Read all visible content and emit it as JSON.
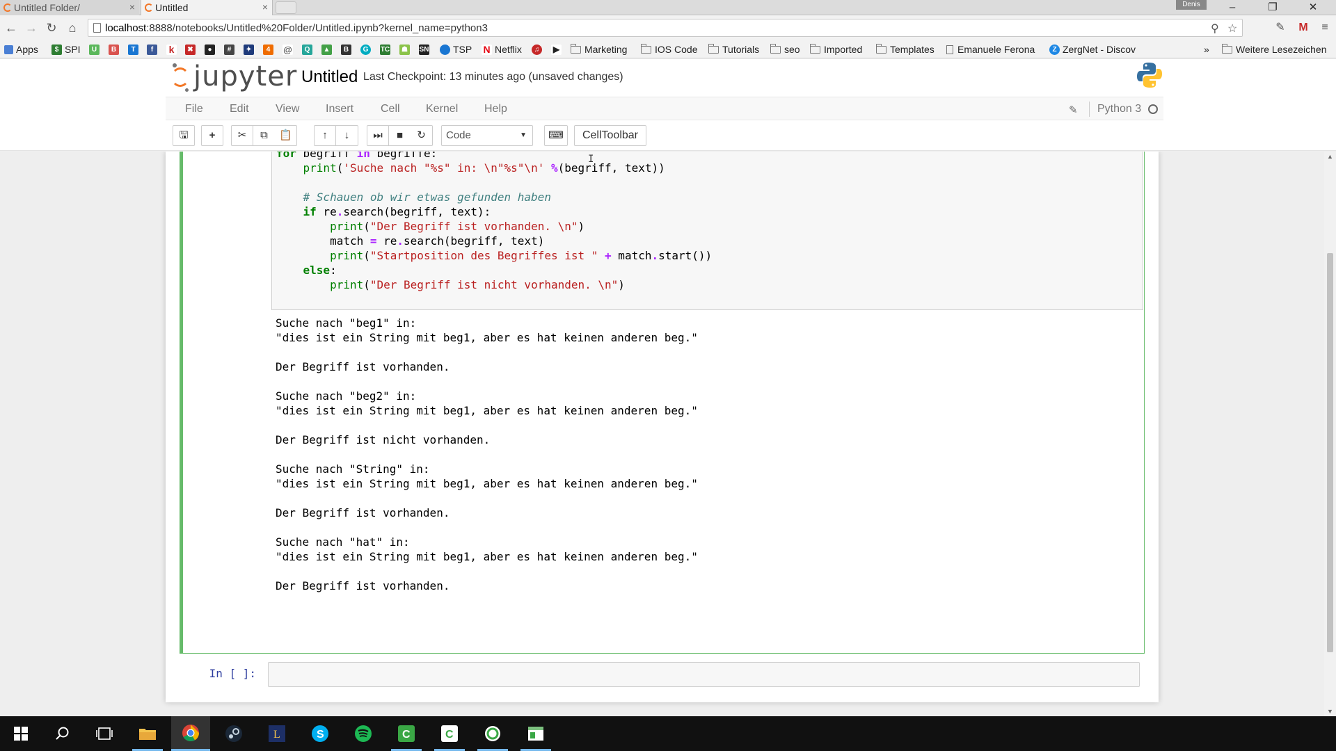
{
  "browser": {
    "tabs": [
      {
        "title": "Untitled Folder/",
        "active": false
      },
      {
        "title": "Untitled",
        "active": true
      }
    ],
    "profile_name": "Denis",
    "url_host": "localhost",
    "url_rest": ":8888/notebooks/Untitled%20Folder/Untitled.ipynb?kernel_name=python3",
    "bookmarks": {
      "apps": "Apps",
      "spi": "SPI",
      "tsp": "TSP",
      "netflix": "Netflix",
      "marketing": "Marketing",
      "ios_code": "IOS Code",
      "tutorials": "Tutorials",
      "seo": "seo",
      "imported": "Imported",
      "templates": "Templates",
      "emanuele": "Emanuele Ferona",
      "zergnet": "ZergNet - Discov",
      "overflow": "»",
      "weitere": "Weitere Lesezeichen"
    }
  },
  "jupyter": {
    "logo_text": "jupyter",
    "notebook_name": "Untitled",
    "checkpoint": "Last Checkpoint: 13 minutes ago (unsaved changes)",
    "menu": [
      "File",
      "Edit",
      "View",
      "Insert",
      "Cell",
      "Kernel",
      "Help"
    ],
    "kernel_name": "Python 3",
    "cell_type": "Code",
    "celltoolbar": "CellToolbar",
    "next_prompt": "In [ ]:"
  },
  "output_text": "Suche nach \"beg1\" in:\n\"dies ist ein String mit beg1, aber es hat keinen anderen beg.\"\n\nDer Begriff ist vorhanden.\n\nSuche nach \"beg2\" in:\n\"dies ist ein String mit beg1, aber es hat keinen anderen beg.\"\n\nDer Begriff ist nicht vorhanden.\n\nSuche nach \"String\" in:\n\"dies ist ein String mit beg1, aber es hat keinen anderen beg.\"\n\nDer Begriff ist vorhanden.\n\nSuche nach \"hat\" in:\n\"dies ist ein String mit beg1, aber es hat keinen anderen beg.\"\n\nDer Begriff ist vorhanden.",
  "colors": {
    "accent_orange": "#f37726",
    "selected_cell_green": "#66bb6a",
    "keyword_green": "#008000",
    "string_red": "#ba2121",
    "comment_teal": "#408080",
    "prompt_blue": "#303f9f"
  }
}
